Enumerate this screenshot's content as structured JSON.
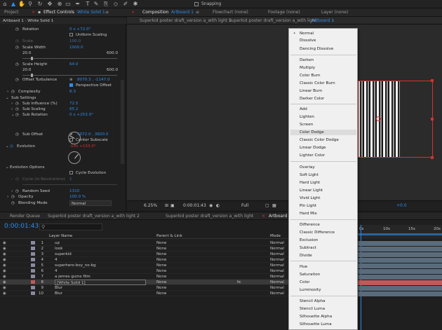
{
  "toolbar": {
    "snapping_label": "Snapping",
    "tools": [
      "select-tool",
      "hand-tool",
      "zoom-tool",
      "orbit-tool",
      "anchor-tool",
      "rect-tool",
      "pen-tool",
      "type-tool",
      "brush-tool",
      "clone-tool",
      "eraser-tool",
      "roto-tool",
      "puppet-tool"
    ]
  },
  "left_panel": {
    "tab_project": "Project",
    "tab_effect_controls": "Effect Controls",
    "tab_effect_target": "White Solid 1",
    "subtitle": "Artboard 1 · White Solid 1",
    "properties": [
      {
        "label": "Rotation",
        "value": "0 x +72.0°"
      },
      {
        "label": "Uniform Scaling",
        "value": ""
      },
      {
        "label": "Scale",
        "value": "100.0"
      },
      {
        "label": "Scale Width",
        "value": "1000.0"
      },
      {
        "label": "20.0",
        "value": ""
      },
      {
        "label": "Scale Height",
        "value": "64.0"
      },
      {
        "label": "20.0",
        "value": ""
      },
      {
        "label": "Offset Turbulence",
        "value": "8070.3 , -1147.0"
      },
      {
        "label": "Perspective Offset",
        "value": ""
      },
      {
        "label": "Complexity",
        "value": "8.3"
      },
      {
        "label": "Sub Settings",
        "value": ""
      },
      {
        "label": "Sub Influence (%)",
        "value": "72.5"
      },
      {
        "label": "Sub Scaling",
        "value": "65.2"
      },
      {
        "label": "Sub Rotation",
        "value": "0 x +253.0°"
      },
      {
        "label": "Sub Offset",
        "value": "3072.0 , 3820.0"
      },
      {
        "label": "Center Subscale",
        "value": ""
      },
      {
        "label": "Evolution",
        "value": "-14x +153.0°"
      },
      {
        "label": "Evolution Options",
        "value": ""
      },
      {
        "label": "Cycle Evolution",
        "value": ""
      },
      {
        "label": "Cycle (in Revolutions)",
        "value": "1"
      },
      {
        "label": "Random Seed",
        "value": "1310"
      },
      {
        "label": "Opacity",
        "value": "100.0 %"
      },
      {
        "label": "Blending Mode",
        "value": "Normal"
      }
    ],
    "slider_max": "600.0"
  },
  "viewer": {
    "tab_composition": "Composition",
    "tab_composition_name": "Artboard 1",
    "tab_flowchart": "Flowchart (none)",
    "tab_footage": "Footage (none)",
    "tab_layer": "Layer (none)",
    "comp_tabs": [
      "Superkid poster draft_version a_with light 2",
      "Superkid poster draft_version a_with light",
      "Artboard 1",
      "Superkid poster draft_version a_with light (3)"
    ],
    "footer_zoom": "6.25%",
    "footer_time": "0:00:01:43",
    "footer_res": "Full",
    "footer_exposure": "+0.0"
  },
  "timeline": {
    "tab_render_queue": "Render Queue",
    "comp_tabs": [
      "Superkid poster draft_version a_with light 2",
      "Superkid poster draft_version a_with light",
      "Artboard 1"
    ],
    "timecode": "0:00:01:43",
    "col_layer_name": "Layer Name",
    "col_parent": "Parent & Link",
    "col_mode": "Mode",
    "ruler_marks": [
      "0s",
      "10s",
      "15s",
      "20s"
    ],
    "layers": [
      {
        "num": "1",
        "name": "up",
        "parent": "None",
        "mode": "Normal",
        "color": "#8a8aa0"
      },
      {
        "num": "2",
        "name": "look",
        "parent": "None",
        "mode": "Normal",
        "color": "#8a8aa0"
      },
      {
        "num": "3",
        "name": "superkid",
        "parent": "None",
        "mode": "Normal",
        "color": "#8a8aa0"
      },
      {
        "num": "4",
        "name": "4",
        "parent": "None",
        "mode": "Normal",
        "color": "#8a8aa0"
      },
      {
        "num": "5",
        "name": "superhero-boy_no-bg",
        "parent": "None",
        "mode": "Normal",
        "color": "#8a8aa0"
      },
      {
        "num": "6",
        "name": "4",
        "parent": "None",
        "mode": "Normal",
        "color": "#8a8aa0"
      },
      {
        "num": "7",
        "name": "a jemes   gums film",
        "parent": "None",
        "mode": "Normal",
        "color": "#8a8aa0"
      },
      {
        "num": "8",
        "name": "[White Solid 1]",
        "parent": "None",
        "mode": "Normal",
        "color": "#c05a5a",
        "selected": true
      },
      {
        "num": "9",
        "name": "Blur",
        "parent": "None",
        "mode": "Normal",
        "color": "#8a8aa0"
      },
      {
        "num": "10",
        "name": "Blur",
        "parent": "None",
        "mode": "Normal",
        "color": "#8a8aa0"
      }
    ]
  },
  "blend_menu": {
    "current": "Normal",
    "groups": [
      [
        "Normal",
        "Dissolve",
        "Dancing Dissolve"
      ],
      [
        "Darken",
        "Multiply",
        "Color Burn",
        "Classic Color Burn",
        "Linear Burn",
        "Darker Color"
      ],
      [
        "Add",
        "Lighten",
        "Screen",
        "Color Dodge",
        "Classic Color Dodge",
        "Linear Dodge",
        "Lighter Color"
      ],
      [
        "Overlay",
        "Soft Light",
        "Hard Light",
        "Linear Light",
        "Vivid Light",
        "Pin Light",
        "Hard Mix"
      ],
      [
        "Difference",
        "Classic Difference",
        "Exclusion",
        "Subtract",
        "Divide"
      ],
      [
        "Hue",
        "Saturation",
        "Color",
        "Luminosity"
      ],
      [
        "Stencil Alpha",
        "Stencil Luma",
        "Silhouette Alpha",
        "Silhouette Luma"
      ]
    ]
  },
  "colors": {
    "accent": "#2d8ceb",
    "selection_red": "#d9302f"
  }
}
